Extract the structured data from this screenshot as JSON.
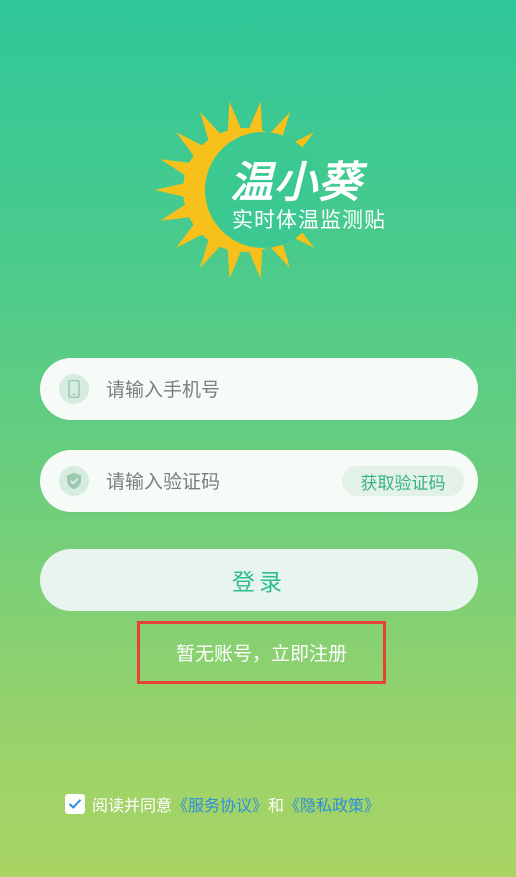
{
  "logo": {
    "title": "温小葵",
    "subtitle": "实时体温监测贴",
    "sun_color": "#f8c01a"
  },
  "phone_field": {
    "placeholder": "请输入手机号",
    "value": ""
  },
  "code_field": {
    "placeholder": "请输入验证码",
    "value": "",
    "get_code_label": "获取验证码"
  },
  "login_label": "登录",
  "register_label": "暂无账号，立即注册",
  "agreement": {
    "checked": true,
    "prefix": "阅读并同意",
    "terms_label": "《服务协议》",
    "conjunction": "和",
    "privacy_label": "《隐私政策》"
  },
  "colors": {
    "accent": "#2cbc8e",
    "link": "#2f8fd8",
    "highlight_border": "#e8413a"
  }
}
